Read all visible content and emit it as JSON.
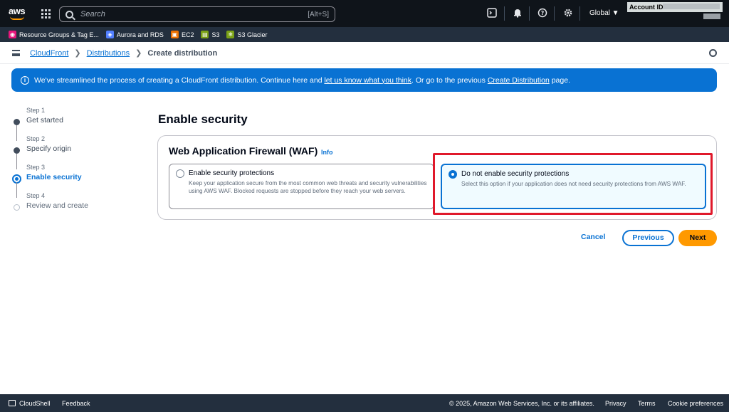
{
  "topnav": {
    "logo": "aws",
    "search_placeholder": "Search",
    "search_shortcut": "[Alt+S]",
    "region": "Global ▼",
    "account_label": "Account ID:",
    "icons": [
      "cloudshell-icon",
      "bell-icon",
      "help-icon",
      "gear-icon"
    ]
  },
  "favorites": [
    {
      "label": "Resource Groups & Tag E...",
      "color": "#e7157b",
      "glyph": "◉"
    },
    {
      "label": "Aurora and RDS",
      "color": "#527fff",
      "glyph": "◈"
    },
    {
      "label": "EC2",
      "color": "#ed7100",
      "glyph": "▣"
    },
    {
      "label": "S3",
      "color": "#7aa116",
      "glyph": "▤"
    },
    {
      "label": "S3 Glacier",
      "color": "#7aa116",
      "glyph": "❄"
    }
  ],
  "breadcrumb": {
    "items": [
      "CloudFront",
      "Distributions"
    ],
    "current": "Create distribution"
  },
  "banner": {
    "text_before": "We've streamlined the process of creating a CloudFront distribution. Continue here and ",
    "link1": "let us know what you think",
    "text_middle": ". Or go to the previous ",
    "link2": "Create Distribution",
    "text_after": " page."
  },
  "steps": [
    {
      "num": "Step 1",
      "name": "Get started"
    },
    {
      "num": "Step 2",
      "name": "Specify origin"
    },
    {
      "num": "Step 3",
      "name": "Enable security"
    },
    {
      "num": "Step 4",
      "name": "Review and create"
    }
  ],
  "main": {
    "title": "Enable security",
    "section_title": "Web Application Firewall (WAF)",
    "info": "Info",
    "options": [
      {
        "label": "Enable security protections",
        "desc": "Keep your application secure from the most common web threats and security vulnerabilities using AWS WAF. Blocked requests are stopped before they reach your web servers.",
        "selected": false
      },
      {
        "label": "Do not enable security protections",
        "desc": "Select this option if your application does not need security protections from AWS WAF.",
        "selected": true
      }
    ]
  },
  "actions": {
    "cancel": "Cancel",
    "previous": "Previous",
    "next": "Next"
  },
  "footer": {
    "cloudshell": "CloudShell",
    "feedback": "Feedback",
    "copyright": "© 2025, Amazon Web Services, Inc. or its affiliates.",
    "privacy": "Privacy",
    "terms": "Terms",
    "cookies": "Cookie preferences"
  }
}
